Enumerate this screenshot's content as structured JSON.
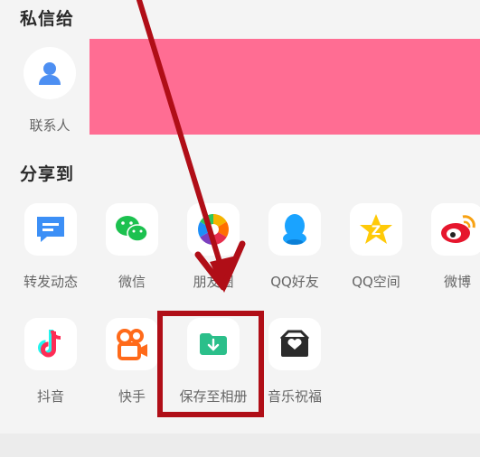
{
  "sections": {
    "private_message_title": "私信给",
    "share_to_title": "分享到"
  },
  "contact": {
    "label": "联系人"
  },
  "apps_row1": [
    {
      "label": "转发动态",
      "icon": "repost-icon"
    },
    {
      "label": "微信",
      "icon": "wechat-icon"
    },
    {
      "label": "朋友圈",
      "icon": "moments-icon"
    },
    {
      "label": "QQ好友",
      "icon": "qq-icon"
    },
    {
      "label": "QQ空间",
      "icon": "qzone-icon"
    },
    {
      "label": "微博",
      "icon": "weibo-icon"
    }
  ],
  "apps_row2": [
    {
      "label": "抖音",
      "icon": "douyin-icon"
    },
    {
      "label": "快手",
      "icon": "kuaishou-icon"
    },
    {
      "label": "保存至相册",
      "icon": "save-to-album-icon"
    },
    {
      "label": "音乐祝福",
      "icon": "music-greeting-icon"
    }
  ],
  "colors": {
    "banner": "#ff6d93",
    "highlight": "#b00e17",
    "wechat": "#1cc14f",
    "repost": "#3c8ff6",
    "qq": "#1aa3ff",
    "qzone": "#ffca08",
    "weibo": "#e6162d",
    "save": "#2bbf8a"
  }
}
